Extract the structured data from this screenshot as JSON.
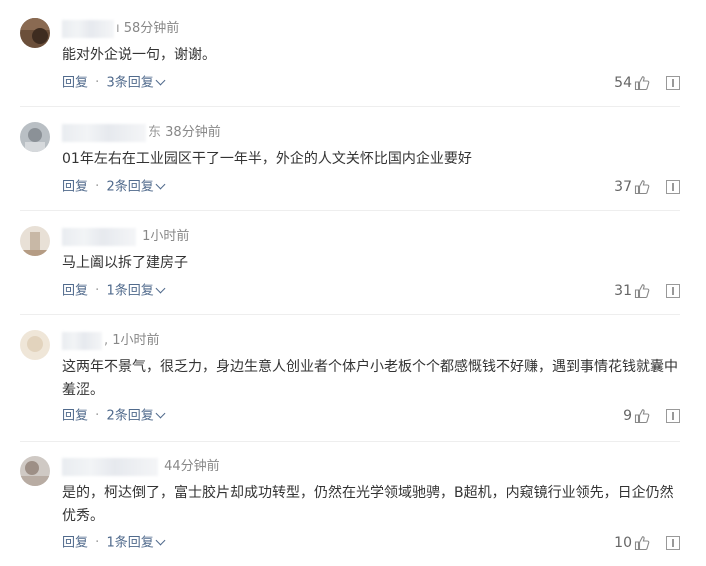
{
  "comments": [
    {
      "name_visible": "",
      "name_tail": "ı",
      "time": "58分钟前",
      "text": "能对外企说一句，谢谢。",
      "reply_label": "回复",
      "replies_label": "3条回复",
      "likes": "54"
    },
    {
      "name_visible": "",
      "name_tail": "东",
      "time": "38分钟前",
      "text": "01年左右在工业园区干了一年半，外企的人文关怀比国内企业要好",
      "reply_label": "回复",
      "replies_label": "2条回复",
      "likes": "37"
    },
    {
      "name_visible": "",
      "name_tail": "",
      "time": "1小时前",
      "text": "马上阖以拆了建房子",
      "reply_label": "回复",
      "replies_label": "1条回复",
      "likes": "31"
    },
    {
      "name_visible": "",
      "name_tail": ",",
      "time": "1小时前",
      "text": "这两年不景气，很乏力，身边生意人创业者个体户小老板个个都感慨钱不好赚，遇到事情花钱就囊中羞涩。",
      "reply_label": "回复",
      "replies_label": "2条回复",
      "likes": "9"
    },
    {
      "name_visible": "",
      "name_tail": "",
      "time": "44分钟前",
      "text": "是的，柯达倒了，富士胶片却成功转型，仍然在光学领域驰骋，B超机，内窥镜行业领先，日企仍然优秀。",
      "reply_label": "回复",
      "replies_label": "1条回复",
      "likes": "10"
    }
  ],
  "separator": "·",
  "icons": {
    "like": "thumbs-up-icon",
    "report": "report-icon",
    "chevron": "chevron-down-icon"
  },
  "colors": {
    "link": "#506a8c",
    "meta": "#999999",
    "text": "#333333"
  }
}
